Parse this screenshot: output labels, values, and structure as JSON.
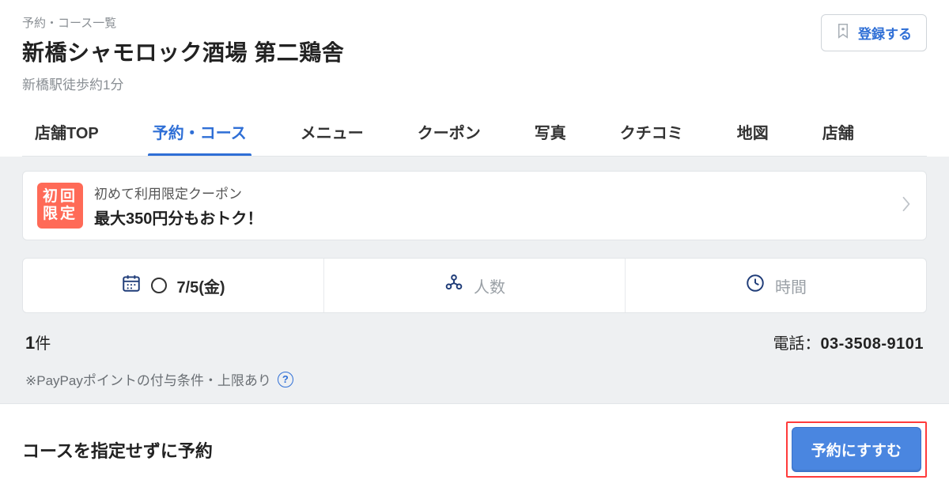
{
  "header": {
    "breadcrumb": "予約・コース一覧",
    "restaurant_name": "新橋シャモロック酒場 第二鶏舎",
    "station_info": "新橋駅徒歩約1分",
    "register_label": "登録する"
  },
  "tabs": {
    "items": [
      {
        "label": "店舗TOP",
        "active": false
      },
      {
        "label": "予約・コース",
        "active": true
      },
      {
        "label": "メニュー",
        "active": false
      },
      {
        "label": "クーポン",
        "active": false
      },
      {
        "label": "写真",
        "active": false
      },
      {
        "label": "クチコミ",
        "active": false
      },
      {
        "label": "地図",
        "active": false
      },
      {
        "label": "店舗",
        "active": false
      }
    ]
  },
  "coupon": {
    "badge_line1": "初回",
    "badge_line2": "限定",
    "line1": "初めて利用限定クーポン",
    "line2": "最大350円分もおトク！"
  },
  "selector": {
    "date_value": "7/5(金)",
    "people_placeholder": "人数",
    "time_placeholder": "時間"
  },
  "meta": {
    "count_number": "1",
    "count_unit": "件",
    "phone_label": "電話：",
    "phone_number": "03-3508-9101"
  },
  "note": {
    "text": "※PayPayポイントの付与条件・上限あり",
    "help_glyph": "?"
  },
  "cta": {
    "text": "コースを指定せずに予約",
    "button_label": "予約にすすむ"
  }
}
